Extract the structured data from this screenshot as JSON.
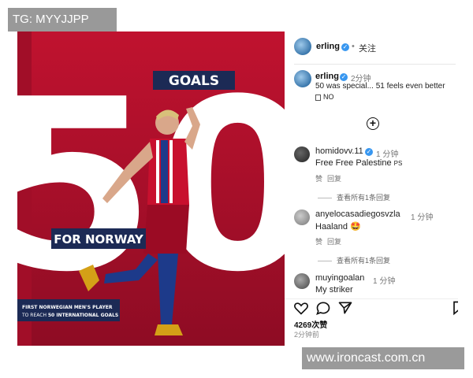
{
  "watermark_top": "TG: MYYJJPP",
  "watermark_bottom": "www.ironcast.com.cn",
  "image": {
    "big_number": "50",
    "goals_badge": "GOALS",
    "for_norway": "FOR NORWAY",
    "subtitle_line1": "FIRST NORWEGIAN MEN'S PLAYER",
    "subtitle_line2_prefix": "TO REACH ",
    "subtitle_line2_bold": "50 INTERNATIONAL GOALS",
    "colors": {
      "background": "#b5102e",
      "badge": "#1c2a55"
    }
  },
  "post": {
    "username": "erling",
    "separator": "•",
    "follow": "关注",
    "caption": {
      "username": "erling",
      "time": "2分钟",
      "text": "50 was special... 51 feels even better",
      "flag_text": "NO"
    },
    "comments": [
      {
        "username": "homidovv.11",
        "time": "1 分钟",
        "text": "Free Free Palestine",
        "flag": "PS",
        "reply": "赞",
        "reply2": "回复",
        "view_replies": "查看所有1条回复"
      },
      {
        "username": "anyelocasadiegosvzla",
        "time": "1 分钟",
        "text": "Haaland",
        "emoji": "🤩",
        "reply": "赞",
        "reply2": "回复",
        "view_replies": "查看所有1条回复"
      },
      {
        "username": "muyingoalan",
        "time": "1 分钟",
        "text": "My striker"
      }
    ],
    "likes": "4269次赞",
    "posted": "2分钟前"
  }
}
